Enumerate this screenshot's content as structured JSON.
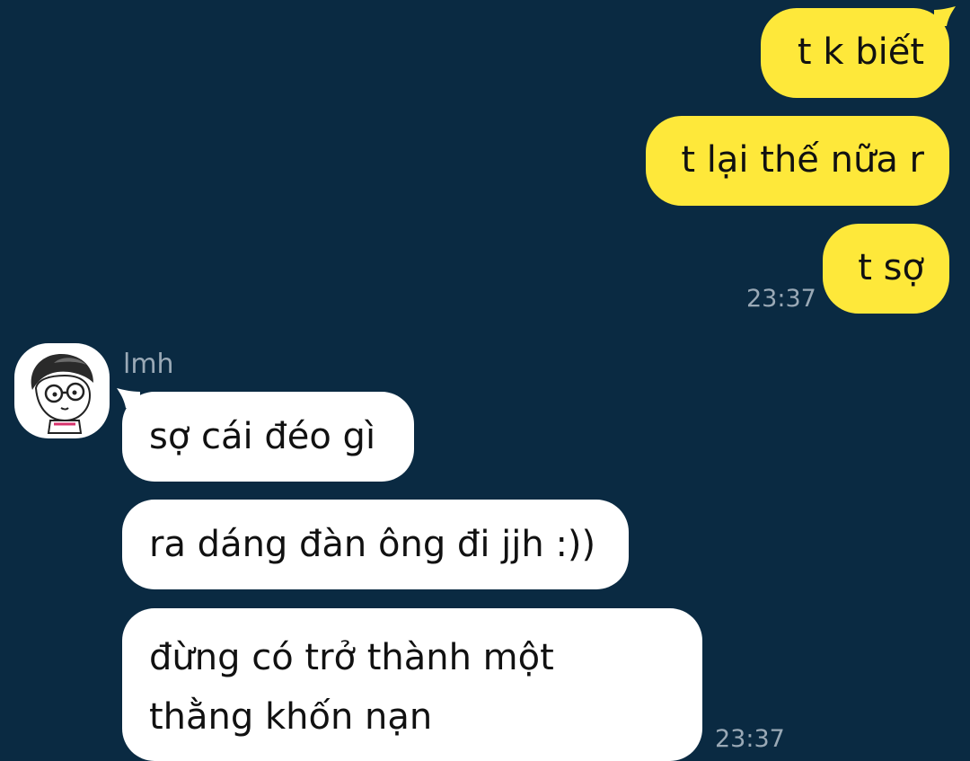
{
  "chat": {
    "outgoing": {
      "color": "#fee83a",
      "messages": [
        "t k biết",
        "t lại thế nữa r",
        "t sợ"
      ],
      "time": "23:37"
    },
    "incoming": {
      "color": "#ffffff",
      "sender_name": "lmh",
      "avatar_icon": "cartoon-boy-glasses-avatar",
      "messages": [
        "sợ cái đéo gì",
        "ra dáng đàn ông đi jjh :))",
        [
          "đừng có trở thành một",
          "thằng khốn nạn"
        ]
      ],
      "time": "23:37"
    },
    "background_color": "#0a2a42"
  }
}
